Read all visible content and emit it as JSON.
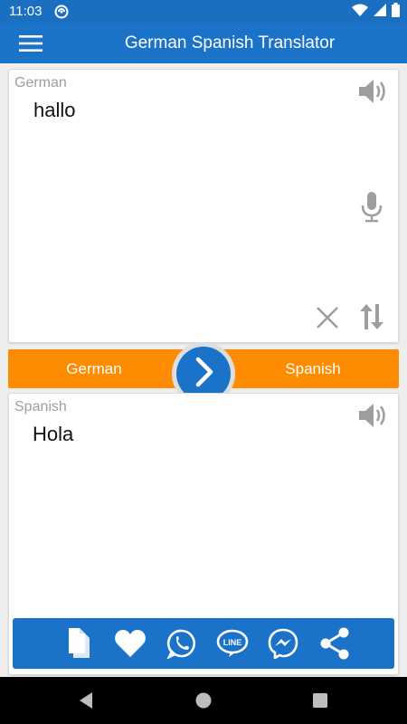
{
  "status_bar": {
    "time": "11:03",
    "icons": [
      "sync-icon",
      "wifi-icon",
      "signal-icon",
      "battery-icon"
    ]
  },
  "app_bar": {
    "title": "German Spanish Translator",
    "menu_icon": "hamburger-menu-icon"
  },
  "source": {
    "language": "German",
    "text": "hallo",
    "icons": [
      "speaker-icon",
      "microphone-icon",
      "clear-icon",
      "swap-vertical-icon"
    ]
  },
  "language_bar": {
    "from": "German",
    "to": "Spanish",
    "translate_icon": "chevron-right-icon"
  },
  "target": {
    "language": "Spanish",
    "text": "Hola",
    "icons": [
      "speaker-icon"
    ]
  },
  "share_bar": {
    "items": [
      "copy-icon",
      "favorite-icon",
      "whatsapp-icon",
      "line-icon",
      "messenger-icon",
      "share-icon"
    ]
  },
  "nav_bar": {
    "items": [
      "back-icon",
      "home-icon",
      "recents-icon"
    ]
  },
  "colors": {
    "primary": "#1a73c9",
    "status_bar": "#1a6fc0",
    "accent": "#ff8c00",
    "icon_gray": "#9e9e9e"
  }
}
